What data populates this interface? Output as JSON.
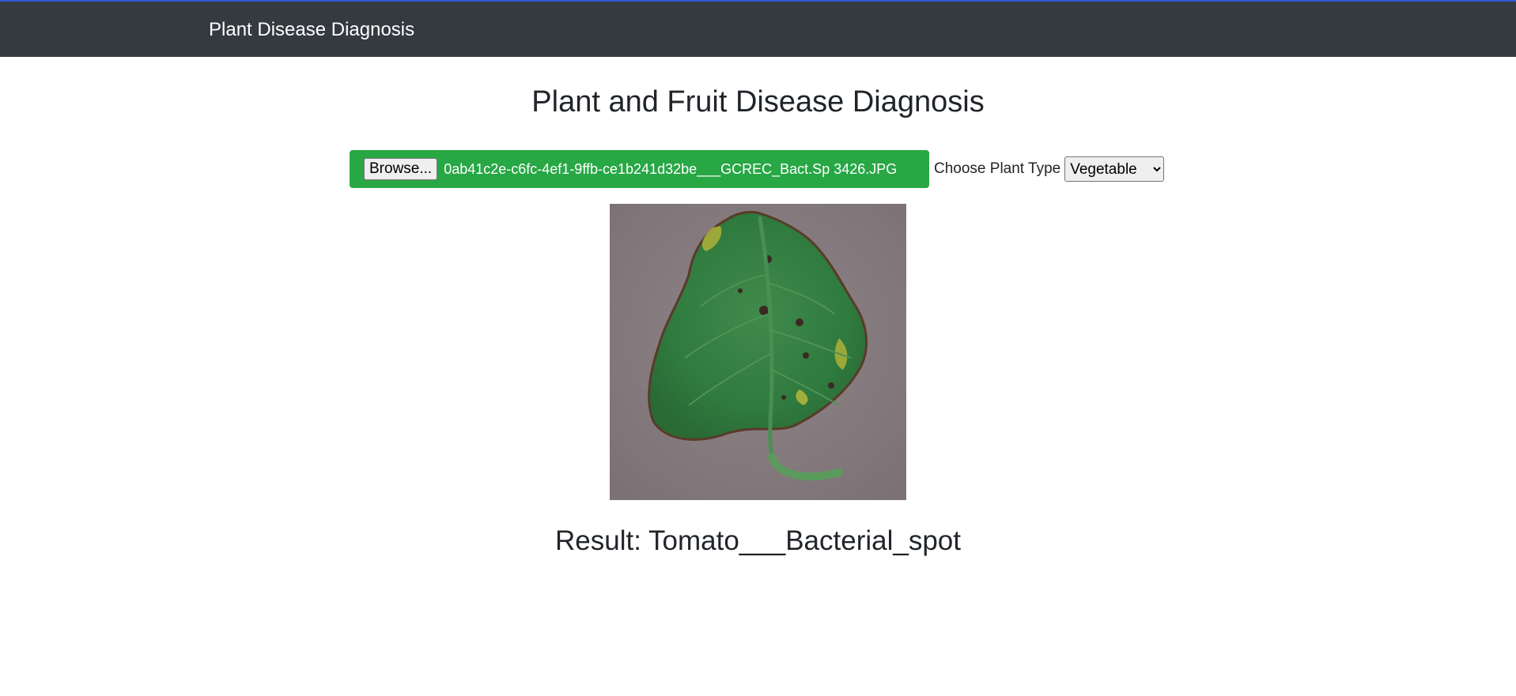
{
  "navbar": {
    "brand": "Plant Disease Diagnosis"
  },
  "main": {
    "title": "Plant and Fruit Disease Diagnosis",
    "upload": {
      "browse_label": "Browse...",
      "file_name": "0ab41c2e-c6fc-4ef1-9ffb-ce1b241d32be___GCREC_Bact.Sp 3426.JPG"
    },
    "plant_type": {
      "label": "Choose Plant Type",
      "selected": "Vegetable"
    },
    "result_text": "Result: Tomato___Bacterial_spot"
  },
  "colors": {
    "navbar_bg": "#343a40",
    "file_box_bg": "#28a745",
    "text": "#212529"
  }
}
